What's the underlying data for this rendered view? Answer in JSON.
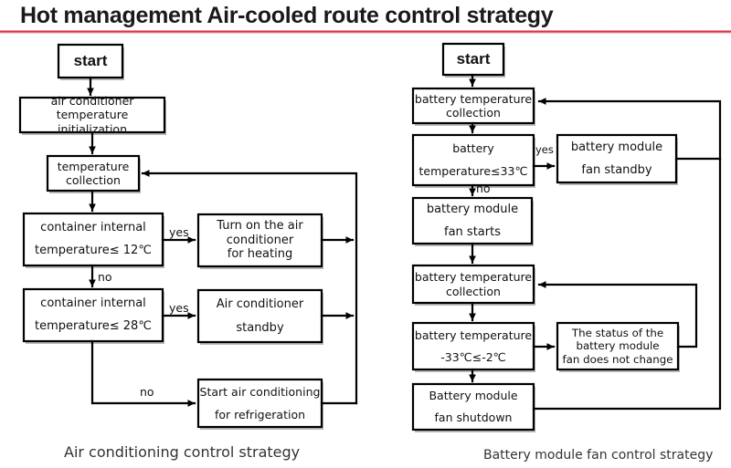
{
  "header": {
    "title": "Hot management Air-cooled route control strategy",
    "rule_color": "#c9202f"
  },
  "diagram": {
    "type": "flowchart",
    "orientation": "two-column",
    "left": {
      "caption": "Air conditioning control strategy",
      "nodes": [
        {
          "id": "l1",
          "label": "start",
          "shape": "rect"
        },
        {
          "id": "l2",
          "label": "air conditioner\ntemperature initialization",
          "shape": "rect"
        },
        {
          "id": "l3",
          "label": "temperature\ncollection",
          "shape": "rect"
        },
        {
          "id": "l4",
          "label": "container internal\ntemperature≤ 12℃",
          "shape": "decision-rect"
        },
        {
          "id": "l5",
          "label": "Turn on the air\nconditioner\nfor heating",
          "shape": "rect"
        },
        {
          "id": "l6",
          "label": "container internal\ntemperature≤ 28℃",
          "shape": "decision-rect"
        },
        {
          "id": "l7",
          "label": "Air conditioner\nstandby",
          "shape": "rect"
        },
        {
          "id": "l8",
          "label": "Start air conditioning\nfor refrigeration",
          "shape": "rect"
        }
      ],
      "edges": [
        {
          "from": "l1",
          "to": "l2",
          "label": ""
        },
        {
          "from": "l2",
          "to": "l3",
          "label": ""
        },
        {
          "from": "l3",
          "to": "l4",
          "label": ""
        },
        {
          "from": "l4",
          "to": "l5",
          "label": "yes"
        },
        {
          "from": "l4",
          "to": "l6",
          "label": "no"
        },
        {
          "from": "l6",
          "to": "l7",
          "label": "yes"
        },
        {
          "from": "l6",
          "to": "l8",
          "label": "no"
        },
        {
          "from": "l5",
          "to": "l3",
          "label": ""
        },
        {
          "from": "l7",
          "to": "l3",
          "label": ""
        },
        {
          "from": "l8",
          "to": "l3",
          "label": ""
        }
      ]
    },
    "right": {
      "caption": "Battery module fan control strategy",
      "nodes": [
        {
          "id": "r1",
          "label": "start",
          "shape": "rect"
        },
        {
          "id": "r2",
          "label": "battery temperature\ncollection",
          "shape": "rect"
        },
        {
          "id": "r3",
          "label": "battery\ntemperature≤33℃",
          "shape": "decision-rect"
        },
        {
          "id": "r4",
          "label": "battery module\nfan standby",
          "shape": "rect"
        },
        {
          "id": "r5",
          "label": "battery module\nfan starts",
          "shape": "rect"
        },
        {
          "id": "r6",
          "label": "battery temperature\ncollection",
          "shape": "rect"
        },
        {
          "id": "r7",
          "label": "battery temperature\n-33℃≤-2℃",
          "shape": "decision-rect"
        },
        {
          "id": "r8",
          "label": "The status of the\nbattery module\nfan does not change",
          "shape": "rect"
        },
        {
          "id": "r9",
          "label": "Battery module\nfan shutdown",
          "shape": "rect"
        }
      ],
      "edges": [
        {
          "from": "r1",
          "to": "r2",
          "label": ""
        },
        {
          "from": "r2",
          "to": "r3",
          "label": ""
        },
        {
          "from": "r3",
          "to": "r4",
          "label": "yes"
        },
        {
          "from": "r3",
          "to": "r5",
          "label": "no"
        },
        {
          "from": "r5",
          "to": "r6",
          "label": ""
        },
        {
          "from": "r6",
          "to": "r7",
          "label": ""
        },
        {
          "from": "r7",
          "to": "r8",
          "label": ""
        },
        {
          "from": "r7",
          "to": "r9",
          "label": ""
        },
        {
          "from": "r4",
          "to": "r2",
          "label": ""
        },
        {
          "from": "r8",
          "to": "r6",
          "label": ""
        },
        {
          "from": "r9",
          "to": "r2",
          "label": ""
        }
      ]
    },
    "edge_labels": {
      "left_yes_1": "yes",
      "left_no_1": "no",
      "left_yes_2": "yes",
      "left_no_2": "no",
      "right_yes_1": "yes",
      "right_no_1": "no"
    }
  },
  "colors": {
    "stroke": "#000000",
    "box_fill": "#ffffff",
    "text": "#111111",
    "caption": "#333333",
    "accent": "#c9202f"
  }
}
